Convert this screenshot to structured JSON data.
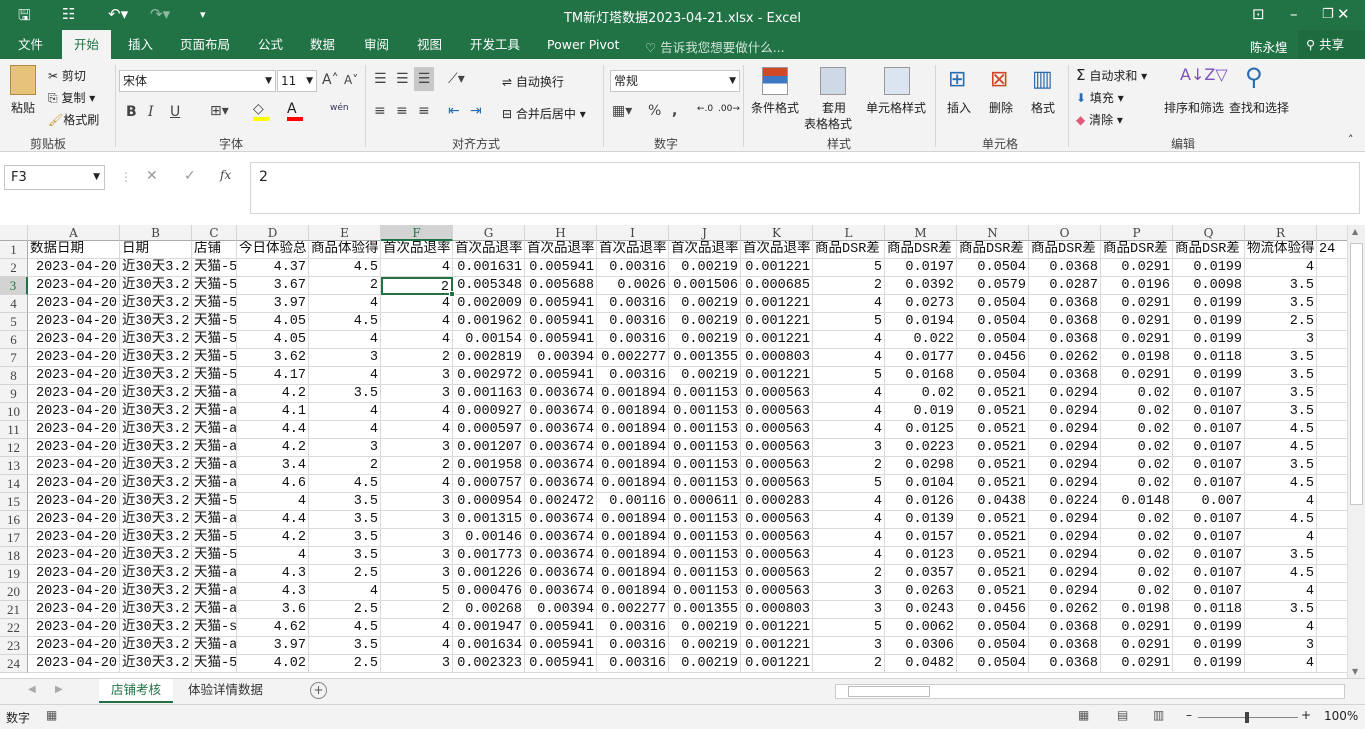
{
  "window": {
    "title": "TM新灯塔数据2023-04-21.xlsx - Excel",
    "user": "陈永煌",
    "share": "共享"
  },
  "ribbon_tabs": [
    "文件",
    "开始",
    "插入",
    "页面布局",
    "公式",
    "数据",
    "审阅",
    "视图",
    "开发工具",
    "Power Pivot"
  ],
  "active_tab": "开始",
  "tell_me": "告诉我您想要做什么...",
  "clipboard": {
    "paste": "粘贴",
    "cut": "剪切",
    "copy": "复制",
    "format_painter": "格式刷",
    "group": "剪贴板"
  },
  "font": {
    "name": "宋体",
    "size": "11",
    "bold": "B",
    "italic": "I",
    "underline": "U",
    "group": "字体",
    "phonetic": "wén"
  },
  "alignment": {
    "wrap": "自动换行",
    "merge": "合并后居中",
    "group": "对齐方式"
  },
  "number": {
    "format": "常规",
    "percent": "%",
    "comma": ",",
    "group": "数字"
  },
  "styles": {
    "conditional": "条件格式",
    "table_l1": "套用",
    "table_l2": "表格格式",
    "cell_styles": "单元格样式",
    "group": "样式"
  },
  "cells": {
    "insert": "插入",
    "delete": "删除",
    "format": "格式",
    "group": "单元格"
  },
  "editing": {
    "autosum": "自动求和",
    "fill": "填充",
    "clear": "清除",
    "sort": "排序和筛选",
    "find": "查找和选择",
    "group": "编辑"
  },
  "formula_bar": {
    "name_box": "F3",
    "value": "2",
    "fx": "fx"
  },
  "colors": {
    "accent": "#217346",
    "fill_yellow": "#ffff00",
    "font_red": "#ff0000"
  },
  "columns": [
    "A",
    "B",
    "C",
    "D",
    "E",
    "F",
    "G",
    "H",
    "I",
    "J",
    "K",
    "L",
    "M",
    "N",
    "O",
    "P",
    "Q",
    "R",
    "S"
  ],
  "selected_cell": {
    "col": "F",
    "row": 3
  },
  "header_row": [
    "数据日期",
    "日期",
    "店铺",
    "今日体验总",
    "商品体验得",
    "首次品退率",
    "首次品退率",
    "首次品退率",
    "首次品退率",
    "首次品退率",
    "首次品退率",
    "商品DSR差",
    "商品DSR差",
    "商品DSR差",
    "商品DSR差",
    "商品DSR差",
    "商品DSR差",
    "物流体验得",
    "24"
  ],
  "rows": [
    [
      "2023-04-20",
      "近30天3.2",
      "天猫-5",
      "4.37",
      "4.5",
      "4",
      "0.001631",
      "0.005941",
      "0.00316",
      "0.00219",
      "0.001221",
      "5",
      "0.0197",
      "0.0504",
      "0.0368",
      "0.0291",
      "0.0199",
      "4",
      ""
    ],
    [
      "2023-04-20",
      "近30天3.2",
      "天猫-5",
      "3.67",
      "2",
      "2",
      "0.005348",
      "0.005688",
      "0.0026",
      "0.001506",
      "0.000685",
      "2",
      "0.0392",
      "0.0579",
      "0.0287",
      "0.0196",
      "0.0098",
      "3.5",
      ""
    ],
    [
      "2023-04-20",
      "近30天3.2",
      "天猫-5",
      "3.97",
      "4",
      "4",
      "0.002009",
      "0.005941",
      "0.00316",
      "0.00219",
      "0.001221",
      "4",
      "0.0273",
      "0.0504",
      "0.0368",
      "0.0291",
      "0.0199",
      "3.5",
      ""
    ],
    [
      "2023-04-20",
      "近30天3.2",
      "天猫-5",
      "4.05",
      "4.5",
      "4",
      "0.001962",
      "0.005941",
      "0.00316",
      "0.00219",
      "0.001221",
      "5",
      "0.0194",
      "0.0504",
      "0.0368",
      "0.0291",
      "0.0199",
      "2.5",
      ""
    ],
    [
      "2023-04-20",
      "近30天3.2",
      "天猫-5",
      "4.05",
      "4",
      "4",
      "0.00154",
      "0.005941",
      "0.00316",
      "0.00219",
      "0.001221",
      "4",
      "0.022",
      "0.0504",
      "0.0368",
      "0.0291",
      "0.0199",
      "3",
      ""
    ],
    [
      "2023-04-20",
      "近30天3.2",
      "天猫-5",
      "3.62",
      "3",
      "2",
      "0.002819",
      "0.00394",
      "0.002277",
      "0.001355",
      "0.000803",
      "4",
      "0.0177",
      "0.0456",
      "0.0262",
      "0.0198",
      "0.0118",
      "3.5",
      ""
    ],
    [
      "2023-04-20",
      "近30天3.2",
      "天猫-5",
      "4.17",
      "4",
      "3",
      "0.002972",
      "0.005941",
      "0.00316",
      "0.00219",
      "0.001221",
      "5",
      "0.0168",
      "0.0504",
      "0.0368",
      "0.0291",
      "0.0199",
      "3.5",
      ""
    ],
    [
      "2023-04-20",
      "近30天3.2",
      "天猫-a",
      "4.2",
      "3.5",
      "3",
      "0.001163",
      "0.003674",
      "0.001894",
      "0.001153",
      "0.000563",
      "4",
      "0.02",
      "0.0521",
      "0.0294",
      "0.02",
      "0.0107",
      "3.5",
      ""
    ],
    [
      "2023-04-20",
      "近30天3.2",
      "天猫-a",
      "4.1",
      "4",
      "4",
      "0.000927",
      "0.003674",
      "0.001894",
      "0.001153",
      "0.000563",
      "4",
      "0.019",
      "0.0521",
      "0.0294",
      "0.02",
      "0.0107",
      "3.5",
      ""
    ],
    [
      "2023-04-20",
      "近30天3.2",
      "天猫-a",
      "4.4",
      "4",
      "4",
      "0.000597",
      "0.003674",
      "0.001894",
      "0.001153",
      "0.000563",
      "4",
      "0.0125",
      "0.0521",
      "0.0294",
      "0.02",
      "0.0107",
      "4.5",
      ""
    ],
    [
      "2023-04-20",
      "近30天3.2",
      "天猫-a",
      "4.2",
      "3",
      "3",
      "0.001207",
      "0.003674",
      "0.001894",
      "0.001153",
      "0.000563",
      "3",
      "0.0223",
      "0.0521",
      "0.0294",
      "0.02",
      "0.0107",
      "4.5",
      ""
    ],
    [
      "2023-04-20",
      "近30天3.2",
      "天猫-a",
      "3.4",
      "2",
      "2",
      "0.001958",
      "0.003674",
      "0.001894",
      "0.001153",
      "0.000563",
      "2",
      "0.0298",
      "0.0521",
      "0.0294",
      "0.02",
      "0.0107",
      "3.5",
      ""
    ],
    [
      "2023-04-20",
      "近30天3.2",
      "天猫-a",
      "4.6",
      "4.5",
      "4",
      "0.000757",
      "0.003674",
      "0.001894",
      "0.001153",
      "0.000563",
      "5",
      "0.0104",
      "0.0521",
      "0.0294",
      "0.02",
      "0.0107",
      "4.5",
      ""
    ],
    [
      "2023-04-20",
      "近30天3.2",
      "天猫-5",
      "4",
      "3.5",
      "3",
      "0.000954",
      "0.002472",
      "0.00116",
      "0.000611",
      "0.000283",
      "4",
      "0.0126",
      "0.0438",
      "0.0224",
      "0.0148",
      "0.007",
      "4",
      ""
    ],
    [
      "2023-04-20",
      "近30天3.2",
      "天猫-a",
      "4.4",
      "3.5",
      "3",
      "0.001315",
      "0.003674",
      "0.001894",
      "0.001153",
      "0.000563",
      "4",
      "0.0139",
      "0.0521",
      "0.0294",
      "0.02",
      "0.0107",
      "4.5",
      ""
    ],
    [
      "2023-04-20",
      "近30天3.2",
      "天猫-5",
      "4.2",
      "3.5",
      "3",
      "0.00146",
      "0.003674",
      "0.001894",
      "0.001153",
      "0.000563",
      "4",
      "0.0157",
      "0.0521",
      "0.0294",
      "0.02",
      "0.0107",
      "4",
      ""
    ],
    [
      "2023-04-20",
      "近30天3.2",
      "天猫-5",
      "4",
      "3.5",
      "3",
      "0.001773",
      "0.003674",
      "0.001894",
      "0.001153",
      "0.000563",
      "4",
      "0.0123",
      "0.0521",
      "0.0294",
      "0.02",
      "0.0107",
      "3.5",
      ""
    ],
    [
      "2023-04-20",
      "近30天3.2",
      "天猫-a",
      "4.3",
      "2.5",
      "3",
      "0.001226",
      "0.003674",
      "0.001894",
      "0.001153",
      "0.000563",
      "2",
      "0.0357",
      "0.0521",
      "0.0294",
      "0.02",
      "0.0107",
      "4.5",
      ""
    ],
    [
      "2023-04-20",
      "近30天3.2",
      "天猫-a",
      "4.3",
      "4",
      "5",
      "0.000476",
      "0.003674",
      "0.001894",
      "0.001153",
      "0.000563",
      "3",
      "0.0263",
      "0.0521",
      "0.0294",
      "0.02",
      "0.0107",
      "4",
      ""
    ],
    [
      "2023-04-20",
      "近30天3.2",
      "天猫-a",
      "3.6",
      "2.5",
      "2",
      "0.00268",
      "0.00394",
      "0.002277",
      "0.001355",
      "0.000803",
      "3",
      "0.0243",
      "0.0456",
      "0.0262",
      "0.0198",
      "0.0118",
      "3.5",
      ""
    ],
    [
      "2023-04-20",
      "近30天3.2",
      "天猫-s",
      "4.62",
      "4.5",
      "4",
      "0.001947",
      "0.005941",
      "0.00316",
      "0.00219",
      "0.001221",
      "5",
      "0.0062",
      "0.0504",
      "0.0368",
      "0.0291",
      "0.0199",
      "4",
      ""
    ],
    [
      "2023-04-20",
      "近30天3.2",
      "天猫-a",
      "3.97",
      "3.5",
      "4",
      "0.001634",
      "0.005941",
      "0.00316",
      "0.00219",
      "0.001221",
      "3",
      "0.0306",
      "0.0504",
      "0.0368",
      "0.0291",
      "0.0199",
      "3",
      ""
    ],
    [
      "2023-04-20",
      "近30天3.2",
      "天猫-5",
      "4.02",
      "2.5",
      "3",
      "0.002323",
      "0.005941",
      "0.00316",
      "0.00219",
      "0.001221",
      "2",
      "0.0482",
      "0.0504",
      "0.0368",
      "0.0291",
      "0.0199",
      "4",
      ""
    ]
  ],
  "sheets": [
    "店铺考核",
    "体验详情数据"
  ],
  "active_sheet": "店铺考核",
  "status": {
    "mode": "数字",
    "zoom": "100%"
  }
}
